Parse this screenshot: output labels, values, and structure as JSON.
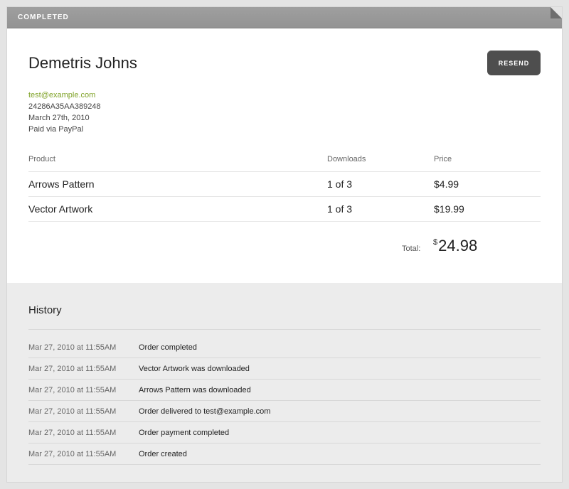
{
  "status": {
    "label": "COMPLETED"
  },
  "order": {
    "customer_name": "Demetris Johns",
    "email": "test@example.com",
    "order_id": "24286A35AA389248",
    "date": "March 27th, 2010",
    "payment": "Paid via PayPal",
    "resend_label": "RESEND"
  },
  "table": {
    "headers": {
      "product": "Product",
      "downloads": "Downloads",
      "price": "Price"
    },
    "rows": [
      {
        "product": "Arrows Pattern",
        "downloads": "1 of 3",
        "price": "$4.99"
      },
      {
        "product": "Vector Artwork",
        "downloads": "1 of 3",
        "price": "$19.99"
      }
    ],
    "total_label": "Total:",
    "total_currency": "$",
    "total_value": "24.98"
  },
  "history": {
    "title": "History",
    "items": [
      {
        "time": "Mar 27, 2010 at 11:55AM",
        "event": "Order completed"
      },
      {
        "time": "Mar 27, 2010 at 11:55AM",
        "event": "Vector Artwork was downloaded"
      },
      {
        "time": "Mar 27, 2010 at 11:55AM",
        "event": "Arrows Pattern was downloaded"
      },
      {
        "time": "Mar 27, 2010 at 11:55AM",
        "event": "Order delivered to test@example.com"
      },
      {
        "time": "Mar 27, 2010 at 11:55AM",
        "event": "Order payment completed"
      },
      {
        "time": "Mar 27, 2010 at 11:55AM",
        "event": "Order created"
      }
    ]
  },
  "colors": {
    "status_bar": "#999999",
    "email_link": "#7fa227",
    "resend_button": "#4e4e4e",
    "history_background": "#ececec"
  }
}
